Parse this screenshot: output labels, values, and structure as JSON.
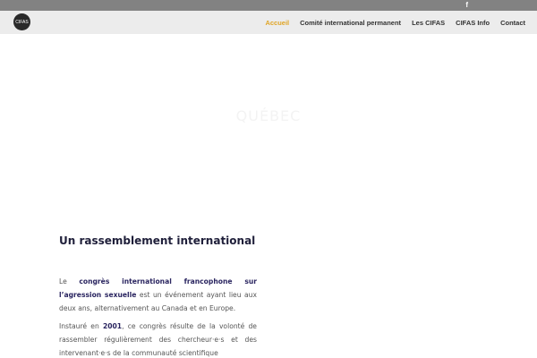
{
  "topbar": {
    "social_icon": "f"
  },
  "header": {
    "logo_text": "CIFAS",
    "nav": [
      {
        "label": "Accueil",
        "active": true
      },
      {
        "label": "Comité international permanent",
        "active": false
      },
      {
        "label": "Les CIFAS",
        "active": false
      },
      {
        "label": "CIFAS Info",
        "active": false
      },
      {
        "label": "Contact",
        "active": false
      }
    ]
  },
  "hero": {
    "title": "QUÉBEC"
  },
  "section": {
    "title": "Un rassemblement international",
    "p1": {
      "lead": "Le ",
      "strong": "congrès international francophone sur l’agression sexuelle",
      "rest": " est un événement ayant lieu aux deux ans, alternativement au Canada et en Europe."
    },
    "p2": {
      "lead": "Instauré en ",
      "strong": "2001",
      "rest": ", ce congrès résulte de la volonté de rassembler régulièrement des chercheur·e·s et des intervenant·e·s de la communauté scientifique"
    }
  },
  "colors": {
    "topbar": "#828282",
    "header": "#ececec",
    "accent": "#e0a526",
    "heading": "#1f1f3a",
    "strong": "#2a2560"
  }
}
